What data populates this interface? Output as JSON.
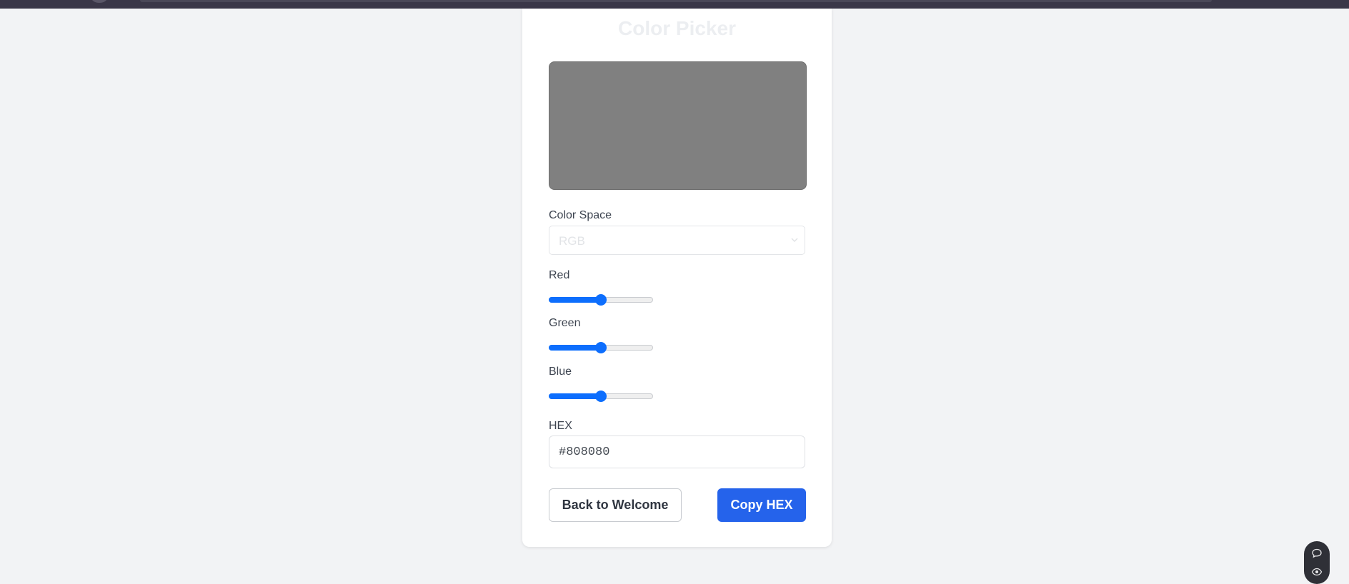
{
  "page": {
    "title": "Color Picker",
    "swatch_color": "#808080"
  },
  "color_space": {
    "label": "Color Space",
    "selected": "RGB"
  },
  "sliders": [
    {
      "label": "Red",
      "value": 128,
      "max": 255
    },
    {
      "label": "Green",
      "value": 128,
      "max": 255
    },
    {
      "label": "Blue",
      "value": 128,
      "max": 255
    }
  ],
  "hex": {
    "label": "HEX",
    "value": "#808080"
  },
  "buttons": {
    "back_label": "Back to Welcome",
    "copy_label": "Copy HEX"
  },
  "colors": {
    "accent": "#0d6efd",
    "primary_button": "#2563eb"
  },
  "icons": {
    "select_chevron": "chevron-down-icon",
    "fab_top": "chat-bubble-icon",
    "fab_bottom": "eye-icon"
  }
}
